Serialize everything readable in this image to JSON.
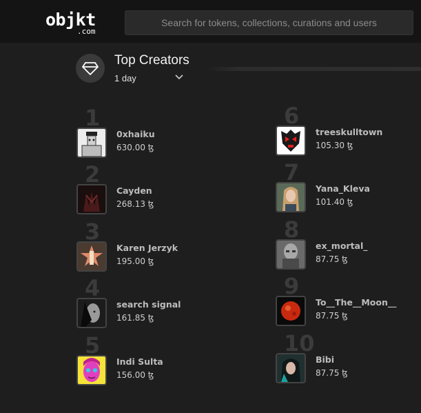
{
  "header": {
    "logo_main": "objkt",
    "logo_sub": ".com",
    "search_placeholder": "Search for tokens, collections, curations and users"
  },
  "section": {
    "title": "Top Creators",
    "period": "1 day",
    "icon": "diamond-icon"
  },
  "creators": [
    {
      "rank": "1",
      "name": "0xhaiku",
      "volume": "630.00 ꜩ",
      "avatar": "sketch-portrait",
      "color": "#e8e8e8"
    },
    {
      "rank": "2",
      "name": "Cayden",
      "volume": "268.13 ꜩ",
      "avatar": "dark-hands",
      "color": "#3a1414"
    },
    {
      "rank": "3",
      "name": "Karen Jerzyk",
      "volume": "195.00 ꜩ",
      "avatar": "star-figure",
      "color": "#5a4a3a"
    },
    {
      "rank": "4",
      "name": "search signal",
      "volume": "161.85 ꜩ",
      "avatar": "bw-face",
      "color": "#2a2a2a"
    },
    {
      "rank": "5",
      "name": "Indi Sulta",
      "volume": "156.00 ꜩ",
      "avatar": "pop-art-face",
      "color": "#f2e23a"
    },
    {
      "rank": "6",
      "name": "treeskulltown",
      "volume": "105.30 ꜩ",
      "avatar": "red-skull",
      "color": "#ffffff"
    },
    {
      "rank": "7",
      "name": "Yana_Kleva",
      "volume": "101.40 ꜩ",
      "avatar": "woman-portrait",
      "color": "#6b7a68"
    },
    {
      "rank": "8",
      "name": "ex_mortal_",
      "volume": "87.75 ꜩ",
      "avatar": "grey-head",
      "color": "#8a8a8a"
    },
    {
      "rank": "9",
      "name": "To__The__Moon__",
      "volume": "87.75 ꜩ",
      "avatar": "red-moon",
      "color": "#111111"
    },
    {
      "rank": "10",
      "name": "Bibi",
      "volume": "87.75 ꜩ",
      "avatar": "woman-dark",
      "color": "#2a3a3a"
    }
  ]
}
